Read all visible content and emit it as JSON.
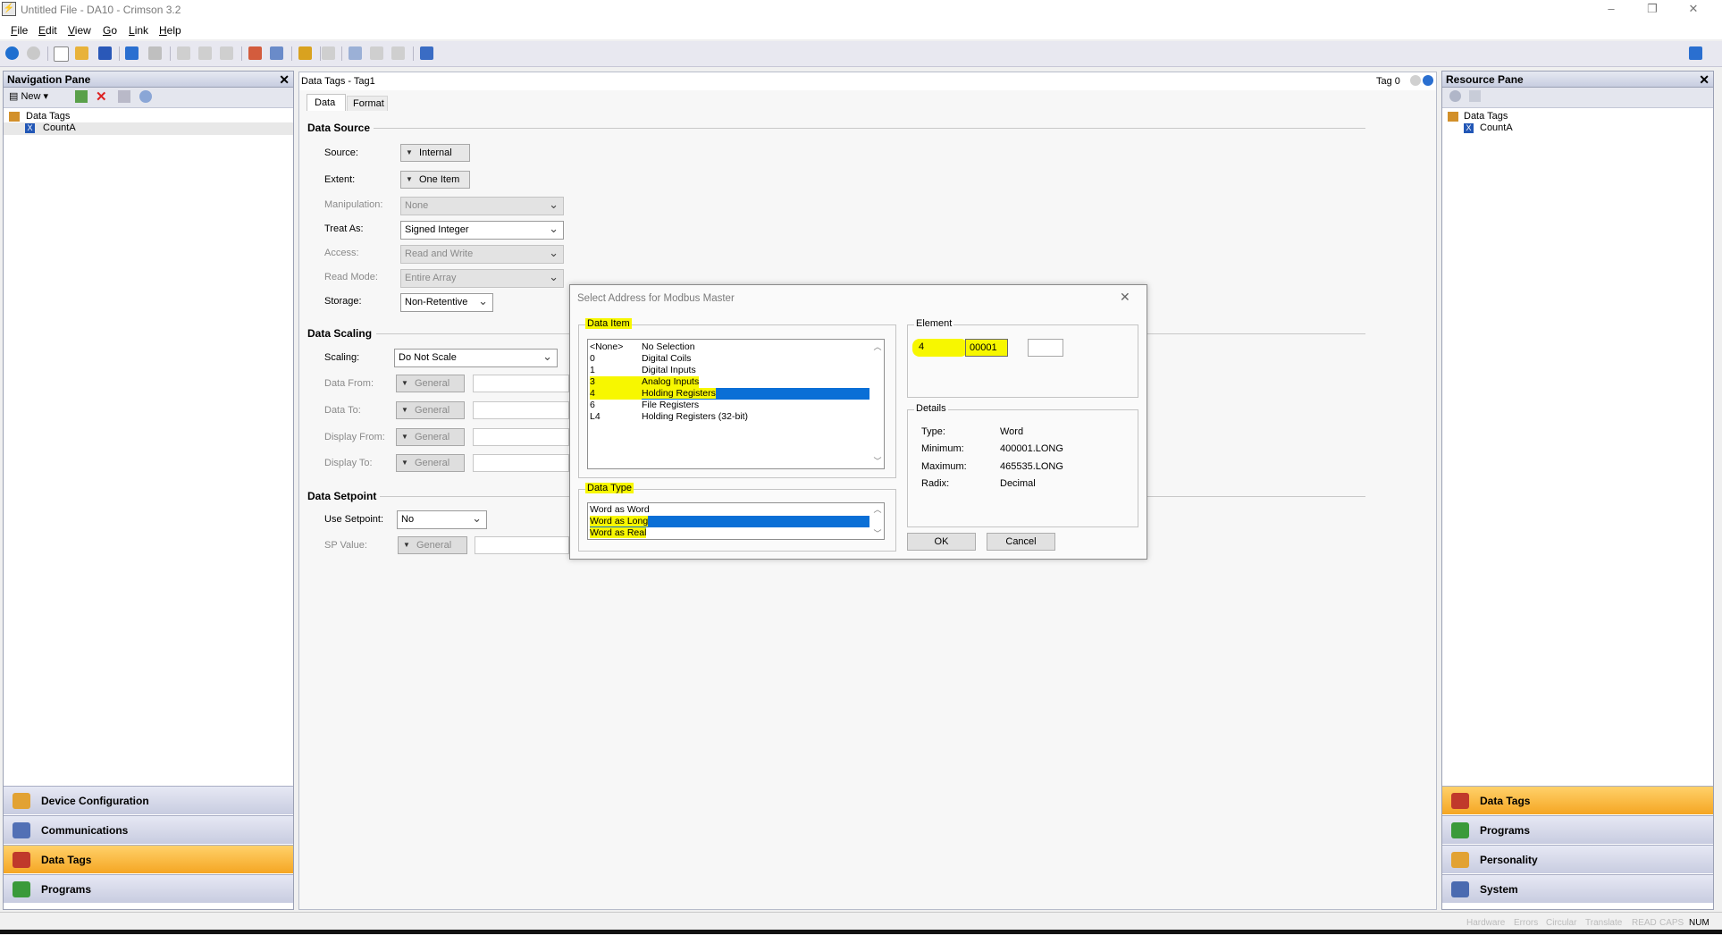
{
  "window": {
    "title": "Untitled File - DA10 - Crimson 3.2",
    "minimize": "–",
    "restore": "❐",
    "close": "✕"
  },
  "menu": [
    {
      "key": "F",
      "rest": "ile"
    },
    {
      "key": "E",
      "rest": "dit"
    },
    {
      "key": "V",
      "rest": "iew"
    },
    {
      "key": "G",
      "rest": "o"
    },
    {
      "key": "L",
      "rest": "ink"
    },
    {
      "key": "H",
      "rest": "elp"
    }
  ],
  "nav_pane": {
    "title": "Navigation Pane",
    "new_label": "New",
    "tree_root": "Data Tags",
    "tree_child": "CountA",
    "buttons": [
      "Device Configuration",
      "Communications",
      "Data Tags",
      "Programs"
    ]
  },
  "resource_pane": {
    "title": "Resource Pane",
    "tree_root": "Data Tags",
    "tree_child": "CountA",
    "buttons": [
      "Data Tags",
      "Programs",
      "Personality",
      "System"
    ]
  },
  "editor": {
    "title": "Data Tags - Tag1",
    "tag_indicator": "Tag 0",
    "tabs": [
      "Data",
      "Format"
    ],
    "data_source": {
      "heading": "Data Source",
      "source_label": "Source:",
      "source_value": "Internal",
      "extent_label": "Extent:",
      "extent_value": "One Item",
      "manipulation_label": "Manipulation:",
      "manipulation_value": "None",
      "treat_as_label": "Treat As:",
      "treat_as_value": "Signed Integer",
      "access_label": "Access:",
      "access_value": "Read and Write",
      "read_mode_label": "Read Mode:",
      "read_mode_value": "Entire Array",
      "storage_label": "Storage:",
      "storage_value": "Non-Retentive"
    },
    "data_scaling": {
      "heading": "Data Scaling",
      "scaling_label": "Scaling:",
      "scaling_value": "Do Not Scale",
      "data_from_label": "Data From:",
      "data_to_label": "Data To:",
      "display_from_label": "Display From:",
      "display_to_label": "Display To:",
      "general": "General"
    },
    "data_setpoint": {
      "heading": "Data Setpoint",
      "use_setpoint_label": "Use Setpoint:",
      "use_setpoint_value": "No",
      "sp_value_label": "SP Value:",
      "general": "General"
    }
  },
  "dialog": {
    "title": "Select Address for Modbus Master",
    "data_item_label": "Data Item",
    "data_items": [
      {
        "code": "<None>",
        "name": "No Selection"
      },
      {
        "code": "0",
        "name": "Digital Coils"
      },
      {
        "code": "1",
        "name": "Digital Inputs"
      },
      {
        "code": "3",
        "name": "Analog Inputs"
      },
      {
        "code": "4",
        "name": "Holding Registers"
      },
      {
        "code": "6",
        "name": "File Registers"
      },
      {
        "code": "L4",
        "name": "Holding Registers (32-bit)"
      }
    ],
    "selected_item_index": 4,
    "data_type_label": "Data Type",
    "data_types": [
      "Word as Word",
      "Word as Long",
      "Word as Real"
    ],
    "selected_type_index": 1,
    "element_label": "Element",
    "element_prefix": "4",
    "element_value": "00001",
    "details_label": "Details",
    "details": [
      {
        "key": "Type:",
        "value": "Word"
      },
      {
        "key": "Minimum:",
        "value": "400001.LONG"
      },
      {
        "key": "Maximum:",
        "value": "465535.LONG"
      },
      {
        "key": "Radix:",
        "value": "Decimal"
      }
    ],
    "ok": "OK",
    "cancel": "Cancel"
  },
  "status_bar": {
    "indicators": [
      "Hardware",
      "Errors",
      "Circular",
      "Translate",
      "READ",
      "CAPS"
    ],
    "active": "NUM"
  },
  "colors": {
    "accent_orange": "#f5a623",
    "selection_blue": "#0a6fd6",
    "highlight_yellow": "#f7f700"
  }
}
